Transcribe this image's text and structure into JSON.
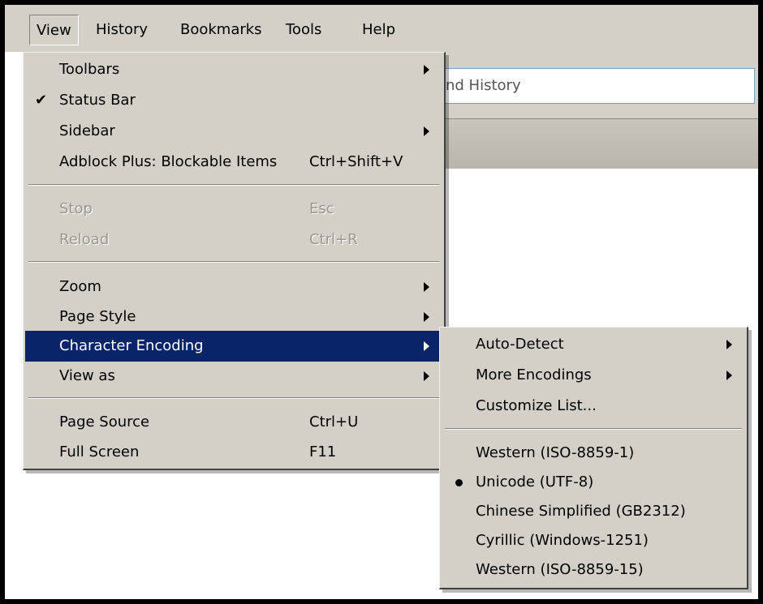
{
  "menubar": {
    "items": [
      {
        "label": "View",
        "mnemonic": "V"
      },
      {
        "label": "History",
        "mnemonic": "s"
      },
      {
        "label": "Bookmarks",
        "mnemonic": "B"
      },
      {
        "label": "Tools",
        "mnemonic": "T"
      },
      {
        "label": "Help",
        "mnemonic": "H"
      }
    ]
  },
  "background": {
    "urlbar_text": "nd History"
  },
  "view_menu": {
    "items": [
      {
        "label": "Toolbars",
        "submenu": true
      },
      {
        "label": "Status Bar",
        "checked": true
      },
      {
        "label": "Sidebar",
        "submenu": true
      },
      {
        "label": "Adblock Plus: Blockable Items",
        "shortcut": "Ctrl+Shift+V"
      },
      {
        "label": "Stop",
        "shortcut": "Esc",
        "disabled": true
      },
      {
        "label": "Reload",
        "shortcut": "Ctrl+R",
        "disabled": true
      },
      {
        "label": "Zoom",
        "submenu": true
      },
      {
        "label": "Page Style",
        "submenu": true
      },
      {
        "label": "Character Encoding",
        "submenu": true,
        "highlighted": true
      },
      {
        "label": "View as",
        "submenu": true
      },
      {
        "label": "Page Source",
        "shortcut": "Ctrl+U"
      },
      {
        "label": "Full Screen",
        "shortcut": "F11"
      }
    ]
  },
  "encoding_menu": {
    "items": [
      {
        "label": "Auto-Detect",
        "submenu": true
      },
      {
        "label": "More Encodings",
        "submenu": true
      },
      {
        "label": "Customize List..."
      },
      {
        "label": "Western (ISO-8859-1)"
      },
      {
        "label": "Unicode (UTF-8)",
        "selected": true
      },
      {
        "label": "Chinese Simplified (GB2312)"
      },
      {
        "label": "Cyrillic (Windows-1251)"
      },
      {
        "label": "Western (ISO-8859-15)"
      }
    ]
  },
  "colors": {
    "menu_bg": "#d4d0c8",
    "highlight_bg": "#0a246a",
    "highlight_fg": "#ffffff",
    "disabled_fg": "#9a9690"
  },
  "icons": [
    "checkmark-icon",
    "submenu-arrow-icon",
    "radio-dot-icon"
  ]
}
